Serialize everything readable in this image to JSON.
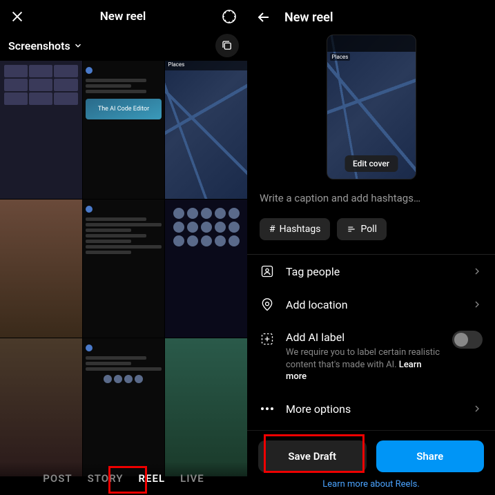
{
  "left": {
    "title": "New reel",
    "album": "Screenshots",
    "tabs": {
      "post": "POST",
      "story": "STORY",
      "reel": "REEL",
      "live": "LIVE"
    },
    "code_tile": "The AI Code Editor",
    "places_label": "Places"
  },
  "right": {
    "title": "New reel",
    "cover": {
      "edit": "Edit cover",
      "places": "Places"
    },
    "caption_placeholder": "Write a caption and add hashtags…",
    "chips": {
      "hashtags": "Hashtags",
      "poll": "Poll"
    },
    "options": {
      "tag": "Tag people",
      "location": "Add location",
      "ai_label": "Add AI label",
      "ai_sub": "We require you to label certain realistic content that's made with AI. ",
      "learn_more": "Learn more",
      "more": "More options"
    },
    "buttons": {
      "draft": "Save Draft",
      "share": "Share"
    },
    "learn_reels": "Learn more about Reels."
  }
}
